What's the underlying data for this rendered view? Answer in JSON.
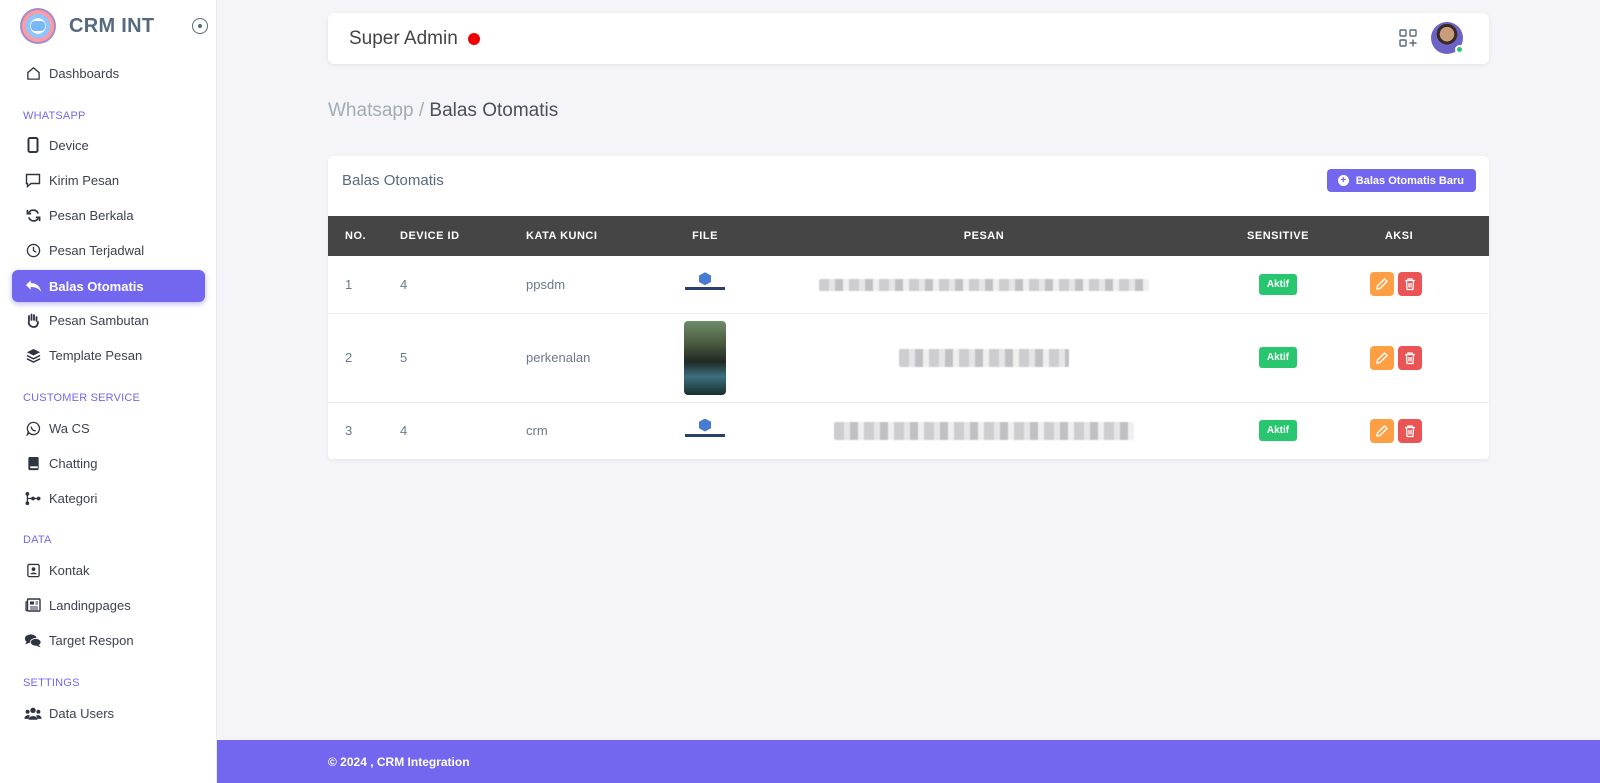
{
  "brand": {
    "name": "CRM INT"
  },
  "sidebar": {
    "dashboards": "Dashboards",
    "sections": {
      "whatsapp": "WHATSAPP",
      "customer_service": "CUSTOMER SERVICE",
      "data": "DATA",
      "settings": "SETTINGS"
    },
    "items": {
      "device": "Device",
      "kirim_pesan": "Kirim Pesan",
      "pesan_berkala": "Pesan Berkala",
      "pesan_terjadwal": "Pesan Terjadwal",
      "balas_otomatis": "Balas Otomatis",
      "pesan_sambutan": "Pesan Sambutan",
      "template_pesan": "Template Pesan",
      "wa_cs": "Wa CS",
      "chatting": "Chatting",
      "kategori": "Kategori",
      "kontak": "Kontak",
      "landingpages": "Landingpages",
      "target_respon": "Target Respon",
      "data_users": "Data Users"
    },
    "active": "balas_otomatis"
  },
  "navbar": {
    "title": "Super Admin",
    "status_color": "#ee0000"
  },
  "breadcrumb": {
    "parent": "Whatsapp /",
    "current": "Balas Otomatis"
  },
  "card": {
    "title": "Balas Otomatis",
    "add_button": "Balas Otomatis Baru",
    "columns": [
      "NO.",
      "DEVICE ID",
      "KATA KUNCI",
      "FILE",
      "PESAN",
      "SENSITIVE",
      "AKSI"
    ],
    "rows": [
      {
        "no": "1",
        "device_id": "4",
        "keyword": "ppsdm",
        "file": "crm-integration-logo",
        "sensitive": "Aktif"
      },
      {
        "no": "2",
        "device_id": "5",
        "keyword": "perkenalan",
        "file": "photo",
        "sensitive": "Aktif"
      },
      {
        "no": "3",
        "device_id": "4",
        "keyword": "crm",
        "file": "crm-integration-logo",
        "sensitive": "Aktif"
      }
    ]
  },
  "footer": {
    "text": "© 2024 , CRM Integration"
  },
  "colors": {
    "primary": "#7367f0",
    "success": "#28c76f",
    "warning": "#ff9f43",
    "danger": "#ea5455",
    "table_header": "#454545"
  }
}
